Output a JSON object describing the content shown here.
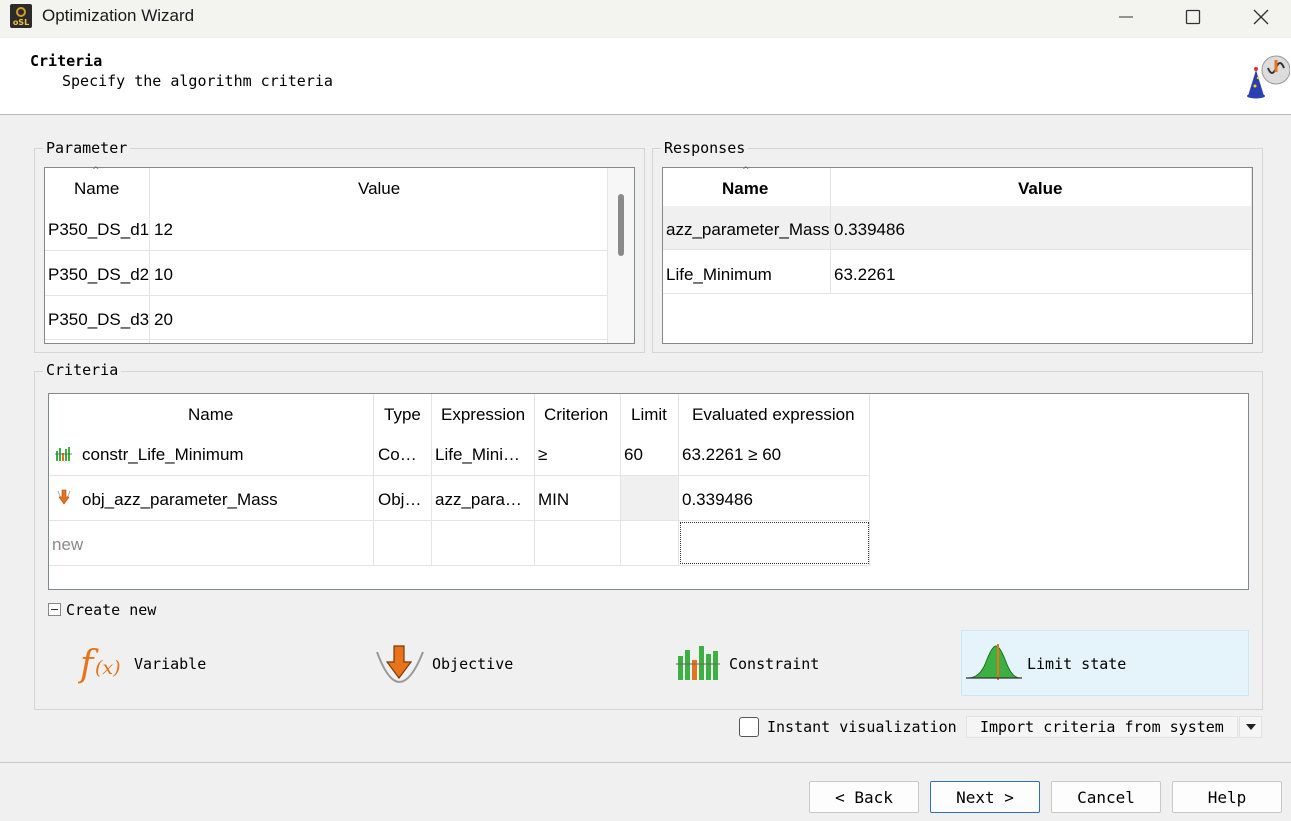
{
  "window": {
    "title": "Optimization Wizard",
    "app_icon_text": "oSL"
  },
  "header": {
    "title": "Criteria",
    "subtitle": "Specify the algorithm criteria"
  },
  "parameter": {
    "group_label": "Parameter",
    "columns": [
      "Name",
      "Value"
    ],
    "rows": [
      {
        "name": "P350_DS_d1",
        "value": "12"
      },
      {
        "name": "P350_DS_d2",
        "value": "10"
      },
      {
        "name": "P350_DS_d3",
        "value": "20"
      }
    ]
  },
  "responses": {
    "group_label": "Responses",
    "columns": [
      "Name",
      "Value"
    ],
    "rows": [
      {
        "name": "azz_parameter_Mass",
        "value": "0.339486"
      },
      {
        "name": "Life_Minimum",
        "value": "63.2261"
      }
    ]
  },
  "criteria": {
    "group_label": "Criteria",
    "columns": [
      "Name",
      "Type",
      "Expression",
      "Criterion",
      "Limit",
      "Evaluated expression"
    ],
    "rows": [
      {
        "icon": "constraint-bars-icon",
        "name": "constr_Life_Minimum",
        "type": "Co…",
        "expression": "Life_Mini…",
        "criterion": "≥",
        "limit": "60",
        "evaluated": "63.2261 ≥ 60"
      },
      {
        "icon": "objective-down-arrow-icon",
        "name": "obj_azz_parameter_Mass",
        "type": "Obj…",
        "expression": "azz_para…",
        "criterion": "MIN",
        "limit": "",
        "evaluated": "0.339486"
      }
    ],
    "new_placeholder": "new"
  },
  "create_new": {
    "label": "Create new",
    "items": [
      {
        "label": "Variable",
        "icon": "function-fx-icon"
      },
      {
        "label": "Objective",
        "icon": "objective-arrow-icon"
      },
      {
        "label": "Constraint",
        "icon": "constraint-icon"
      },
      {
        "label": "Limit state",
        "icon": "limit-state-curve-icon"
      }
    ]
  },
  "options": {
    "instant_visualization_label": "Instant visualization",
    "instant_visualization_checked": false,
    "import_label": "Import criteria from system"
  },
  "footer": {
    "back": "< Back",
    "next": "Next >",
    "cancel": "Cancel",
    "help": "Help"
  },
  "colors": {
    "selection_highlight": "#e5f3fb",
    "default_button_border": "#2f6fbf",
    "accent_orange": "#e8731a",
    "accent_green": "#3cb043"
  }
}
